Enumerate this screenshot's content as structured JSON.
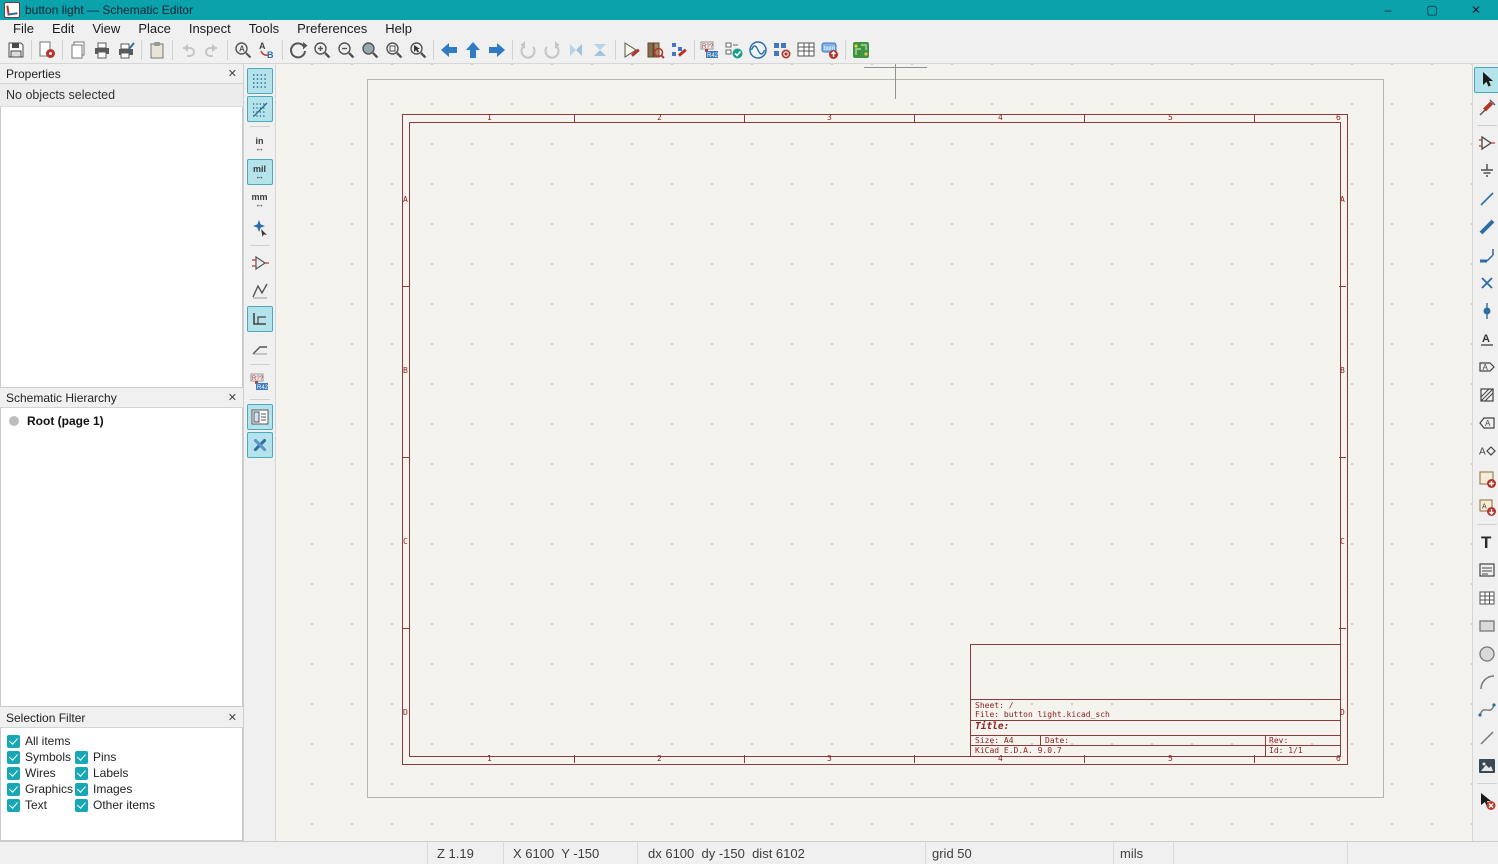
{
  "window": {
    "title": "button light — Schematic Editor",
    "controls": {
      "minimize": "–",
      "maximize": "▢",
      "close": "✕"
    }
  },
  "menu": {
    "items": [
      "File",
      "Edit",
      "View",
      "Place",
      "Inspect",
      "Tools",
      "Preferences",
      "Help"
    ]
  },
  "toolbar_top": {
    "icons": [
      "save",
      "schematic-setup",
      "page-settings",
      "print",
      "plot",
      "paste",
      "undo",
      "redo",
      "find",
      "find-replace",
      "refresh-view",
      "zoom-in",
      "zoom-out",
      "zoom-fit",
      "zoom-objects",
      "zoom-selection",
      "nav-back",
      "nav-up",
      "nav-forward",
      "rotate-ccw",
      "rotate-cw",
      "mirror-vertical",
      "mirror-horizontal",
      "symbol-editor",
      "symbol-browser",
      "footprint-editor",
      "annotate",
      "erc",
      "simulator",
      "assign-footprints",
      "fields-table",
      "bom-export",
      "pcb-editor"
    ]
  },
  "toolbar_left": {
    "icons": [
      "show-grid",
      "grid-overrides",
      "units-inches",
      "units-mils",
      "units-mm",
      "crosshair-style",
      "show-hidden-pins",
      "wire-free-angle",
      "wire-hv-angle",
      "wire-45-angle",
      "annotate-auto",
      "hierarchy-navigator",
      "properties-manager"
    ],
    "active": [
      "show-grid",
      "grid-overrides",
      "units-mils",
      "wire-hv-angle",
      "hierarchy-navigator",
      "properties-manager"
    ],
    "unit_labels": {
      "inches": "in",
      "mils": "mil",
      "mm": "mm",
      "arrows": "↔"
    }
  },
  "toolbar_right": {
    "icons": [
      "select",
      "highlight-net",
      "place-symbol",
      "place-power",
      "wire",
      "bus",
      "bus-entry",
      "no-connect",
      "junction",
      "net-label",
      "global-label",
      "net-class-directive",
      "hierarchical-label",
      "sheet-pin",
      "hierarchical-sheet",
      "import-sheet-pin",
      "text",
      "text-box",
      "table",
      "rectangle",
      "circle",
      "arc",
      "bezier",
      "line",
      "image",
      "delete"
    ],
    "active": [
      "select"
    ]
  },
  "panels": {
    "close_glyph": "✕",
    "properties": {
      "title": "Properties",
      "status": "No objects selected"
    },
    "hierarchy": {
      "title": "Schematic Hierarchy",
      "root": "Root (page 1)"
    },
    "selection_filter": {
      "title": "Selection Filter",
      "items": [
        {
          "label": "All items",
          "checked": true
        },
        {
          "label": "Symbols",
          "checked": true
        },
        {
          "label": "Pins",
          "checked": true
        },
        {
          "label": "Wires",
          "checked": true
        },
        {
          "label": "Labels",
          "checked": true
        },
        {
          "label": "Graphics",
          "checked": true
        },
        {
          "label": "Images",
          "checked": true
        },
        {
          "label": "Text",
          "checked": true
        },
        {
          "label": "Other items",
          "checked": true
        }
      ]
    }
  },
  "sheet": {
    "column_labels": [
      "1",
      "2",
      "3",
      "4",
      "5",
      "6"
    ],
    "row_labels": [
      "A",
      "B",
      "C",
      "D"
    ],
    "title_block": {
      "sheet": "Sheet: /",
      "file": "File: button light.kicad_sch",
      "title_label": "Title:",
      "size": "Size: A4",
      "date": "Date:",
      "rev": "Rev:",
      "generator": "KiCad E.D.A. 9.0.7",
      "page_id": "Id: 1/1"
    }
  },
  "status_bar": {
    "zoom": "Z 1.19",
    "position": "X 6100  Y -150",
    "delta": "dx 6100  dy -150  dist 6102",
    "grid": "grid 50",
    "units": "mils"
  },
  "colors": {
    "titlebar": "#0ba2ac",
    "active_tool_bg": "#b5e3ec",
    "sheet_frame": "#8e3a3a",
    "sheet_text": "#8b2323",
    "tool_blue": "#2e6da4",
    "disabled": "#c5c5c5",
    "check_teal": "#18a7b5"
  }
}
